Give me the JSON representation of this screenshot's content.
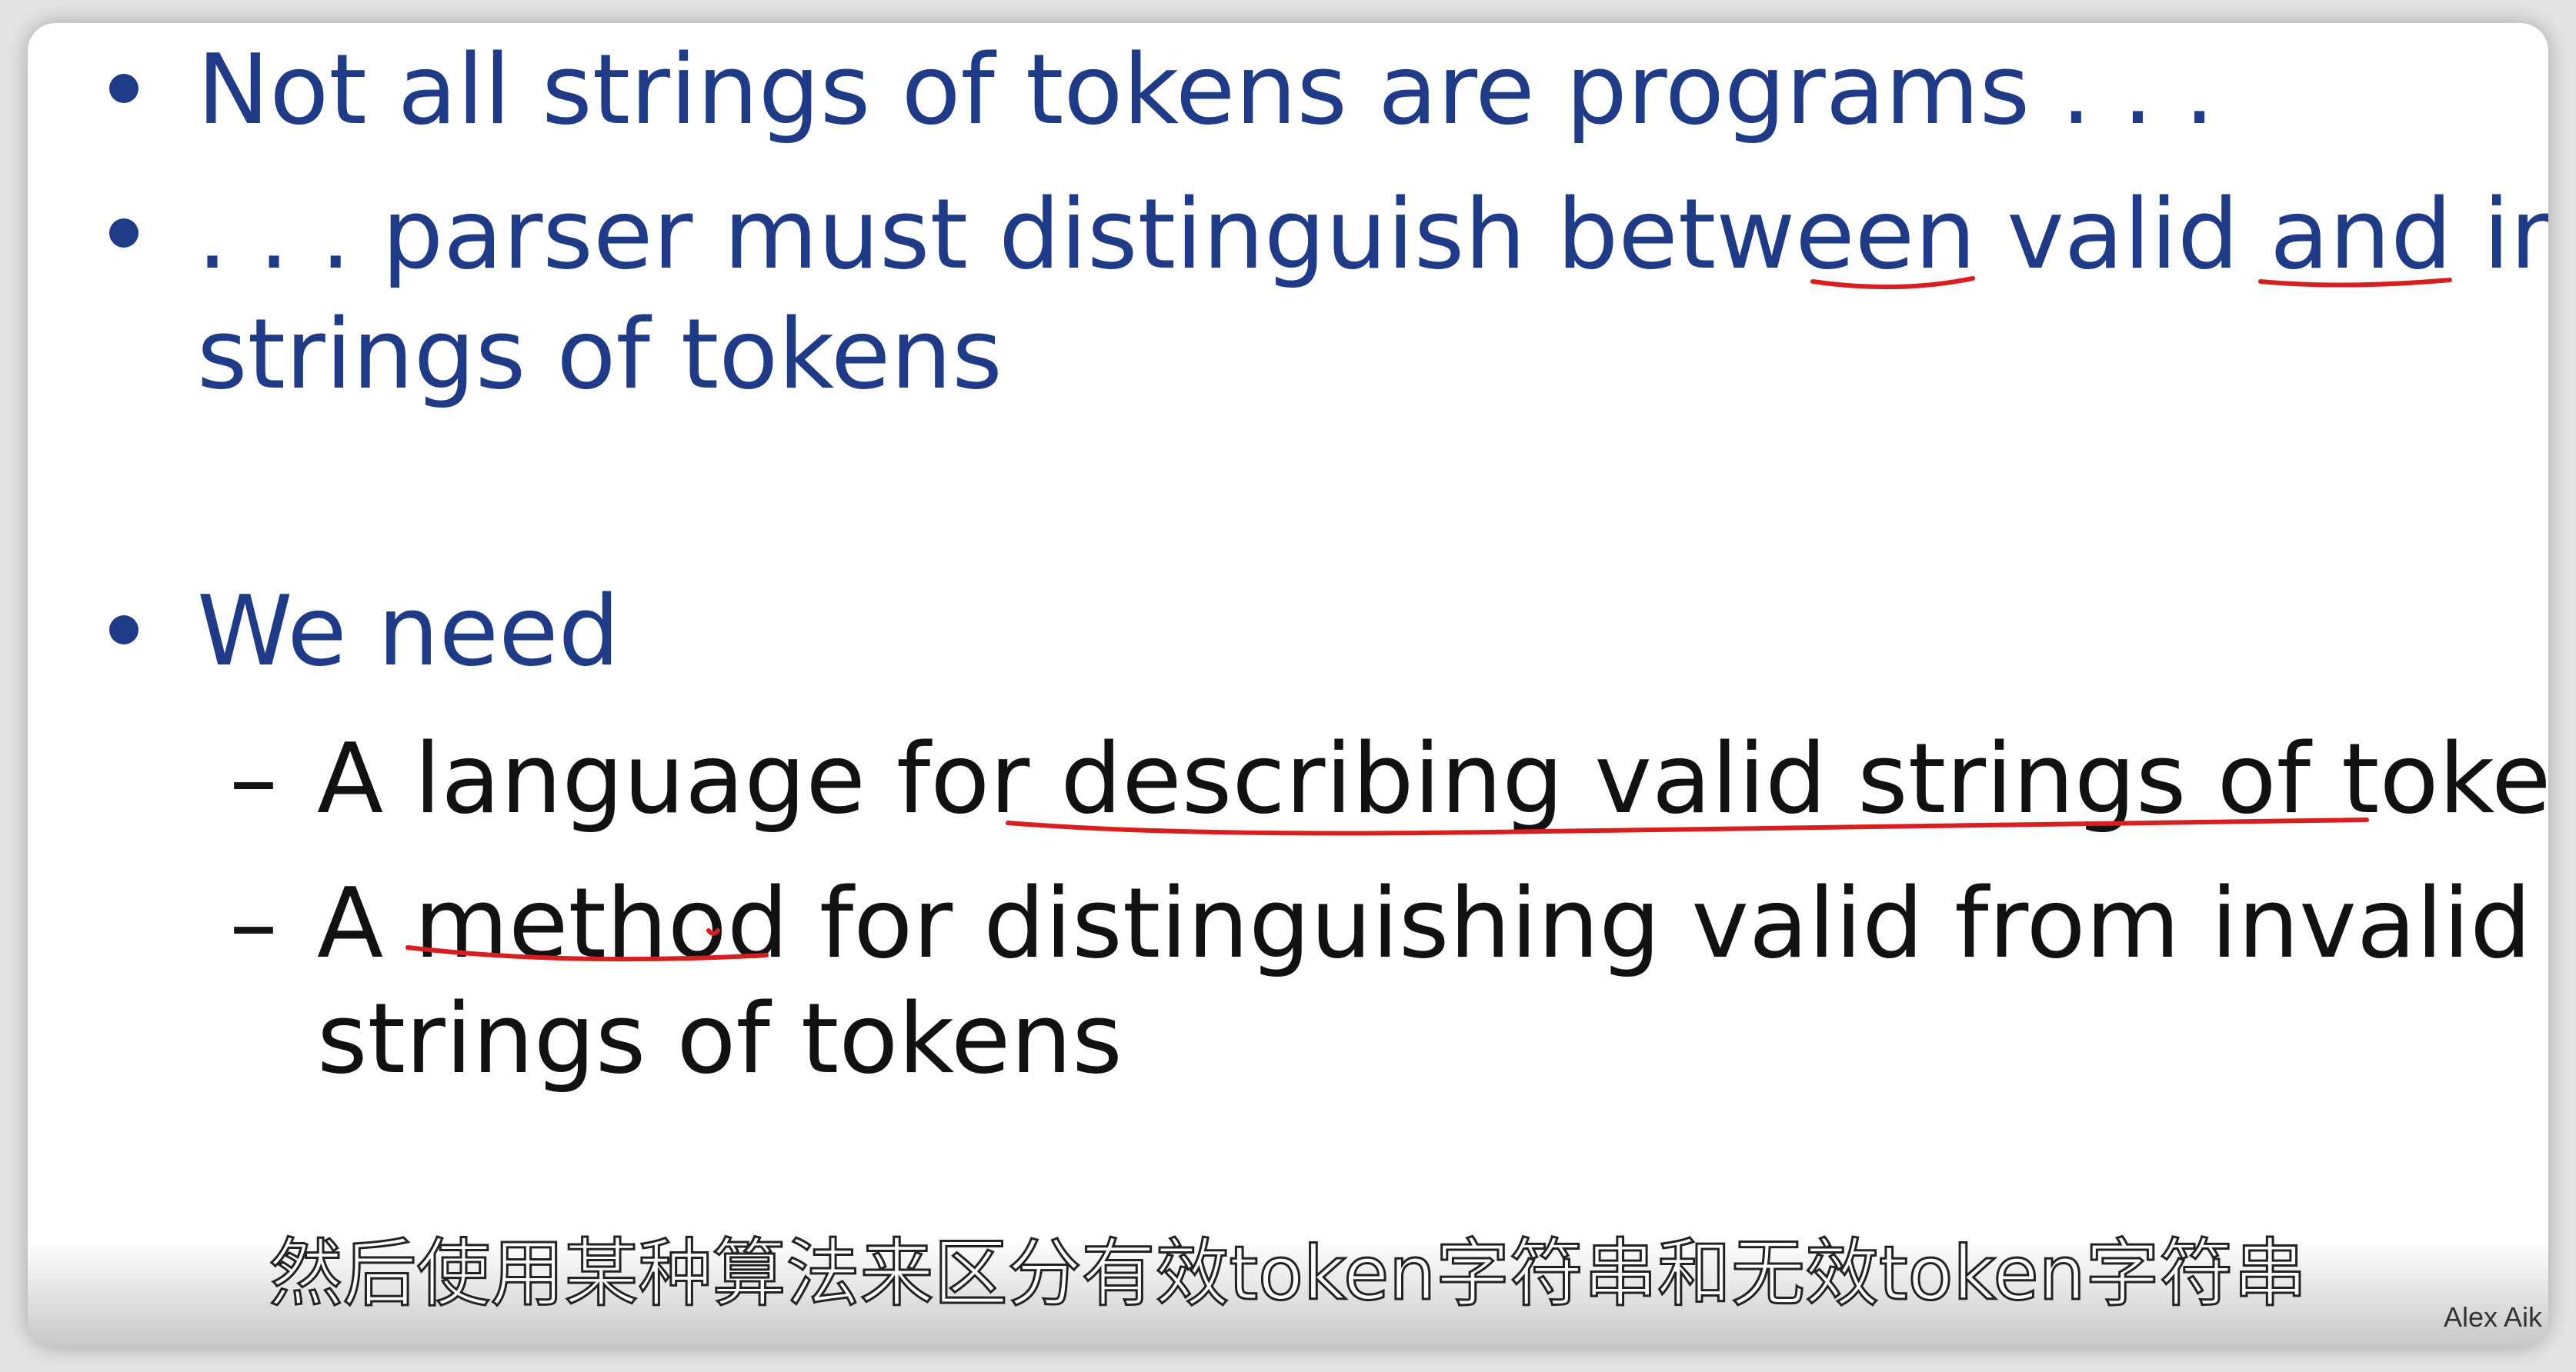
{
  "slide": {
    "bullets": [
      {
        "lines": [
          "Not all strings of tokens are programs . . ."
        ]
      },
      {
        "lines": [
          ". . . parser must distinguish between valid and invalid",
          "strings of tokens"
        ]
      },
      {
        "lines": [
          "We need"
        ]
      }
    ],
    "sub_items": [
      {
        "lines": [
          "A language for describing valid strings of tokens"
        ]
      },
      {
        "lines": [
          "A method for distinguishing valid from invalid",
          "strings of tokens"
        ]
      }
    ],
    "dash_glyph": "–"
  },
  "subtitle": "然后使用某种算法来区分有效token字符串和无效token字符串",
  "watermark": "Alex Aik",
  "colors": {
    "bullet_text": "#1f3a86",
    "sub_text": "#111111",
    "annotation": "#d81e1e"
  }
}
